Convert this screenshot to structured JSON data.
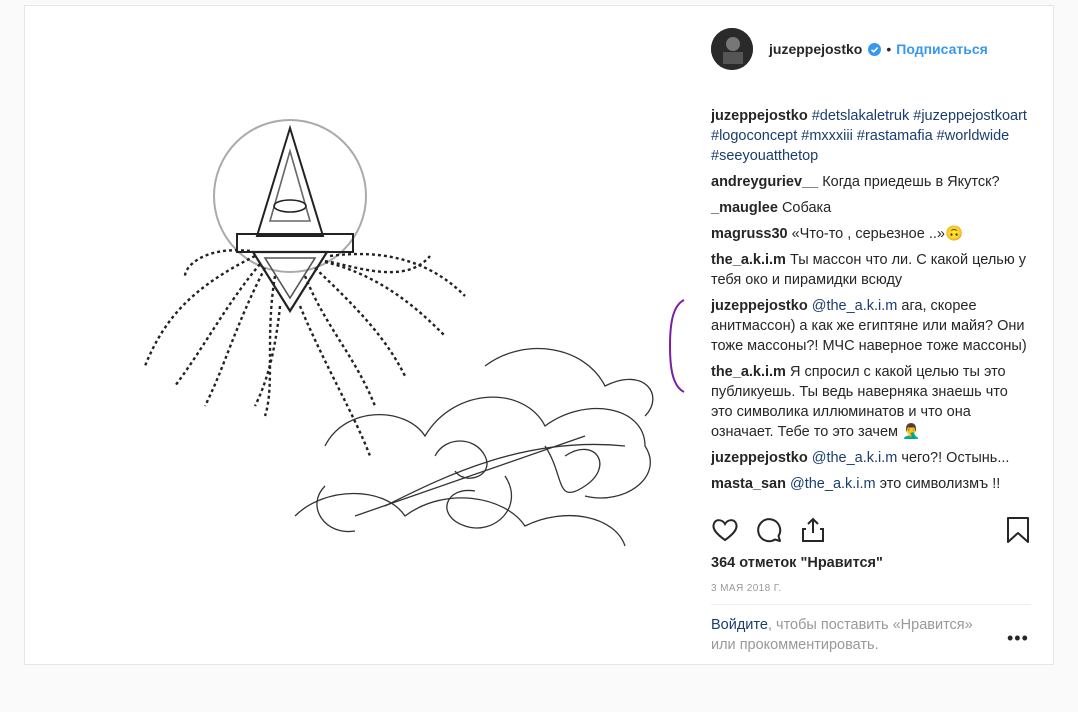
{
  "header": {
    "username": "juzeppejostko",
    "dot": "•",
    "follow_label": "Подписаться"
  },
  "comments": [
    {
      "user": "juzeppejostko",
      "text": "",
      "tags": "#detslakaletruk #juzeppejostkoart #logoconcept #mxxxiii #rastamafia #worldwide #seeyouatthetop"
    },
    {
      "user": "andreyguriev__",
      "text": "Когда приедешь в Якутск?",
      "tags": ""
    },
    {
      "user": "_mauglee",
      "text": "Собака",
      "tags": ""
    },
    {
      "user": "magruss30",
      "text": "«Что-то , серьезное ..»🙃",
      "tags": ""
    },
    {
      "user": "the_a.k.i.m",
      "text": "Ты массон что ли. С какой целью у тебя око и пирамидки всюду",
      "tags": ""
    },
    {
      "user": "juzeppejostko",
      "mention": "@the_a.k.i.m",
      "text": "ага, скорее анитмассон) а как же египтяне или майя? Они тоже массоны?! МЧС наверное тоже массоны)"
    },
    {
      "user": "the_a.k.i.m",
      "text": "Я спросил с какой целью ты это публикуешь. Ты ведь наверняка знаешь что это символика иллюминатов и что она означает. Тебе то это зачем 🤦‍♂️",
      "tags": ""
    },
    {
      "user": "juzeppejostko",
      "mention": "@the_a.k.i.m",
      "text": "чего?! Остынь..."
    },
    {
      "user": "masta_san",
      "mention": "@the_a.k.i.m",
      "text": "это символизмъ !!"
    }
  ],
  "likes_label": "364 отметок \"Нравится\"",
  "date_label": "3 МАЯ 2018 Г.",
  "login": {
    "link_label": "Войдите",
    "text": ", чтобы поставить «Нравится» или прокомментировать."
  },
  "more_label": "•••",
  "icons": {
    "like": "heart-icon",
    "comment": "comment-icon",
    "share": "share-icon",
    "save": "bookmark-icon",
    "verified": "verified-badge-icon"
  },
  "colors": {
    "link_blue": "#3897f0",
    "hashtag": "#1a3e6e",
    "verified": "#3897f0",
    "annotation": "#7b1fa2"
  }
}
